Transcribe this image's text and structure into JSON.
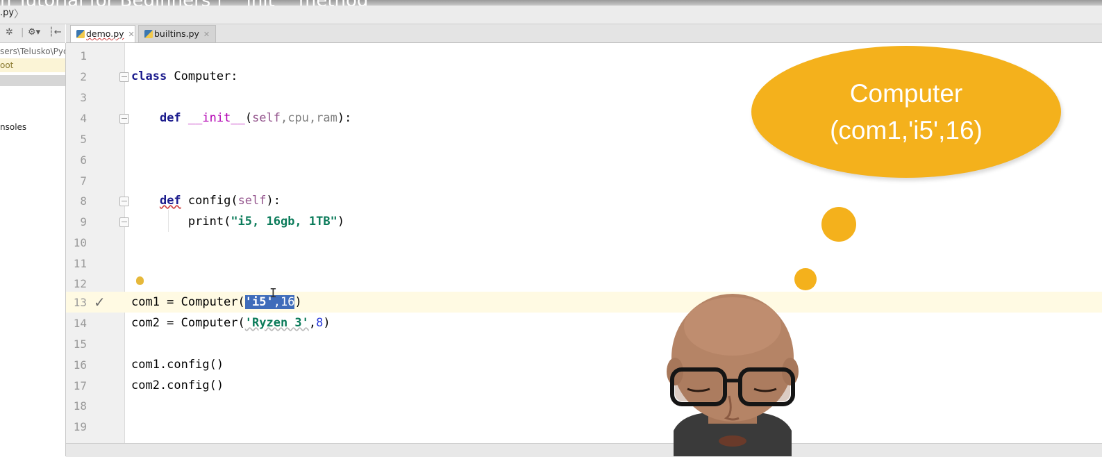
{
  "window": {
    "title_fragment": "n Tutorial for Beginners | __init__ method",
    "breadcrumb": ".py"
  },
  "project_panel": {
    "toolbar_icons": [
      "collapse-icon",
      "settings-icon",
      "hide-panel-icon"
    ],
    "path": "sers\\Telusko\\Pyc",
    "root_label": "oot",
    "consoles_label": "nsoles"
  },
  "tabs": [
    {
      "label": "demo.py",
      "active": true
    },
    {
      "label": "builtins.py",
      "active": false
    }
  ],
  "editor": {
    "line_numbers": [
      "1",
      "2",
      "3",
      "4",
      "5",
      "6",
      "7",
      "8",
      "9",
      "10",
      "11",
      "12",
      "13",
      "14",
      "15",
      "16",
      "17",
      "18",
      "19"
    ],
    "current_line": 13,
    "selection": "'i5',16",
    "code": {
      "l2_kw": "class",
      "l2_rest": " Computer:",
      "l4_kw": "def",
      "l4_fn": "__init__",
      "l4_open": "(",
      "l4_self": "self",
      "l4_params": ",cpu,ram",
      "l4_close": "):",
      "l8_kw": "def",
      "l8_name": " config(",
      "l8_self": "self",
      "l8_close": "):",
      "l9_print": "print(",
      "l9_str": "\"i5, 16gb, 1TB\"",
      "l9_close": ")",
      "l13_pre": "com1 = Computer(",
      "l13_sel_str": "'i5'",
      "l13_sel_comma": ",",
      "l13_sel_num": "16",
      "l13_close": ")",
      "l14_pre": "com2 = Computer(",
      "l14_str": "'Ryzen 3'",
      "l14_comma": ",",
      "l14_num": "8",
      "l14_close": ")",
      "l16": "com1.config()",
      "l17": "com2.config()"
    }
  },
  "bubble": {
    "line1": "Computer",
    "line2": "(com1,'i5',16)"
  },
  "colors": {
    "bubble": "#f4b11c",
    "keyword": "#1a1a8c",
    "string": "#0b7b5a",
    "number": "#2a3bd8",
    "selection": "#3f6cba",
    "current_line": "#fffae3"
  }
}
